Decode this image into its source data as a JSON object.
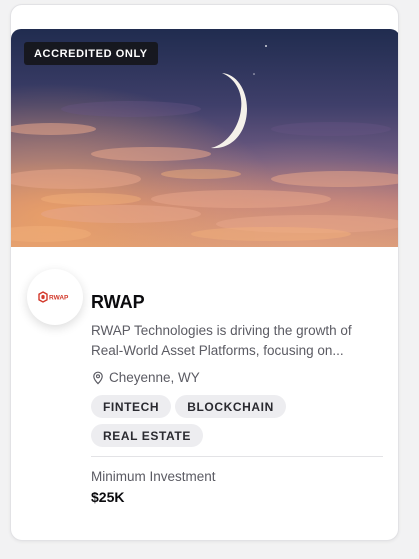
{
  "card": {
    "badge": "ACCREDITED ONLY",
    "logo_text": "RWAP",
    "company_name": "RWAP",
    "description": "RWAP Technologies is driving the growth of Real-World Asset Platforms, focusing on...",
    "location": "Cheyenne, WY",
    "tags": [
      "FINTECH",
      "BLOCKCHAIN",
      "REAL ESTATE"
    ],
    "investment_label": "Minimum Investment",
    "investment_value": "$25K"
  },
  "icons": {
    "location": "map-pin-icon",
    "logo": "rwap-logo"
  },
  "colors": {
    "badge_bg": "#141418",
    "tag_bg": "#ededf0",
    "logo_red": "#d2382a"
  }
}
